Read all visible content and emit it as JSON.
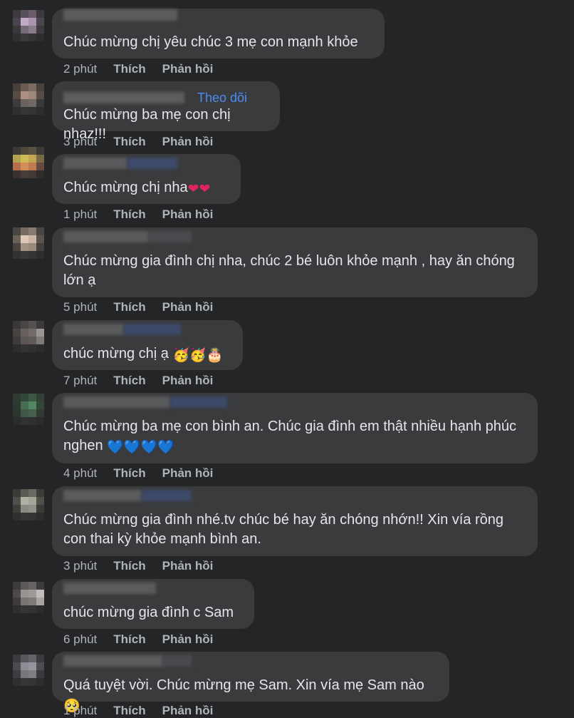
{
  "comments": [
    {
      "text": "Chúc mừng chị yêu chúc 3 mẹ con mạnh khỏe",
      "time": "2 phút",
      "like": "Thích",
      "reply": "Phản hồi",
      "follow": ""
    },
    {
      "text": "Chúc mừng ba mẹ con chị nhaz!!!",
      "time": "3 phút",
      "like": "Thích",
      "reply": "Phản hồi",
      "follow": "Theo dõi"
    },
    {
      "text": "Chúc mừng chị nha",
      "emoji": "❤❤",
      "time": "1 phút",
      "like": "Thích",
      "reply": "Phản hồi",
      "follow": ""
    },
    {
      "text": "Chúc mừng gia đình chị nha, chúc 2 bé luôn khỏe mạnh , hay ăn chóng lớn ạ",
      "time": "5 phút",
      "like": "Thích",
      "reply": "Phản hồi",
      "follow": ""
    },
    {
      "text": "chúc mừng chị ạ",
      "emoji": "🥳🥳🎂",
      "time": "7 phút",
      "like": "Thích",
      "reply": "Phản hồi",
      "follow": ""
    },
    {
      "text": "Chúc mừng ba mẹ con bình an. Chúc gia đình em thật nhiều hạnh phúc nghen",
      "emoji": "💙💙💙💙",
      "time": "4 phút",
      "like": "Thích",
      "reply": "Phản hồi",
      "follow": ""
    },
    {
      "text": "Chúc mừng gia đình nhé.tv chúc bé hay ăn chóng nhớn!! Xin vía rồng con thai kỳ khỏe mạnh bình an.",
      "time": "3 phút",
      "like": "Thích",
      "reply": "Phản hồi",
      "follow": ""
    },
    {
      "text": "chúc mừng gia đình c Sam",
      "time": "6 phút",
      "like": "Thích",
      "reply": "Phản hồi",
      "follow": ""
    },
    {
      "text": "Quá tuyệt vời. Chúc mừng mẹ Sam. Xin vía mẹ Sam nào",
      "emoji": "🥺",
      "time": "1 phút",
      "like": "Thích",
      "reply": "Phản hồi",
      "follow": ""
    }
  ],
  "colors": {
    "background": "#242526",
    "bubble": "#3a3b3c",
    "text": "#e4e6eb",
    "meta": "#b0b3b8",
    "follow": "#4b8bf5"
  }
}
